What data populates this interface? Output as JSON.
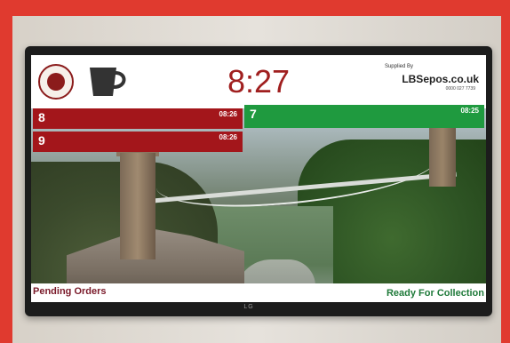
{
  "display": {
    "clock": "8:27",
    "supplier": {
      "label": "Supplied By",
      "name": "LBSepos.co.uk",
      "phone": "0000 027 7739"
    },
    "pending_orders": [
      {
        "number": "8",
        "time": "08:26"
      },
      {
        "number": "9",
        "time": "08:26"
      }
    ],
    "ready_orders": [
      {
        "number": "7",
        "time": "08:25"
      }
    ],
    "footer": {
      "pending_label": "Pending Orders",
      "ready_label": "Ready For Collection"
    },
    "tv_brand": "LG"
  },
  "colors": {
    "pending": "#a3161b",
    "ready": "#1f9a3f",
    "clock": "#a01f1f",
    "frame": "#e03a2f"
  },
  "icons": [
    "coffee-cup-icon",
    "university-seal-logo"
  ]
}
